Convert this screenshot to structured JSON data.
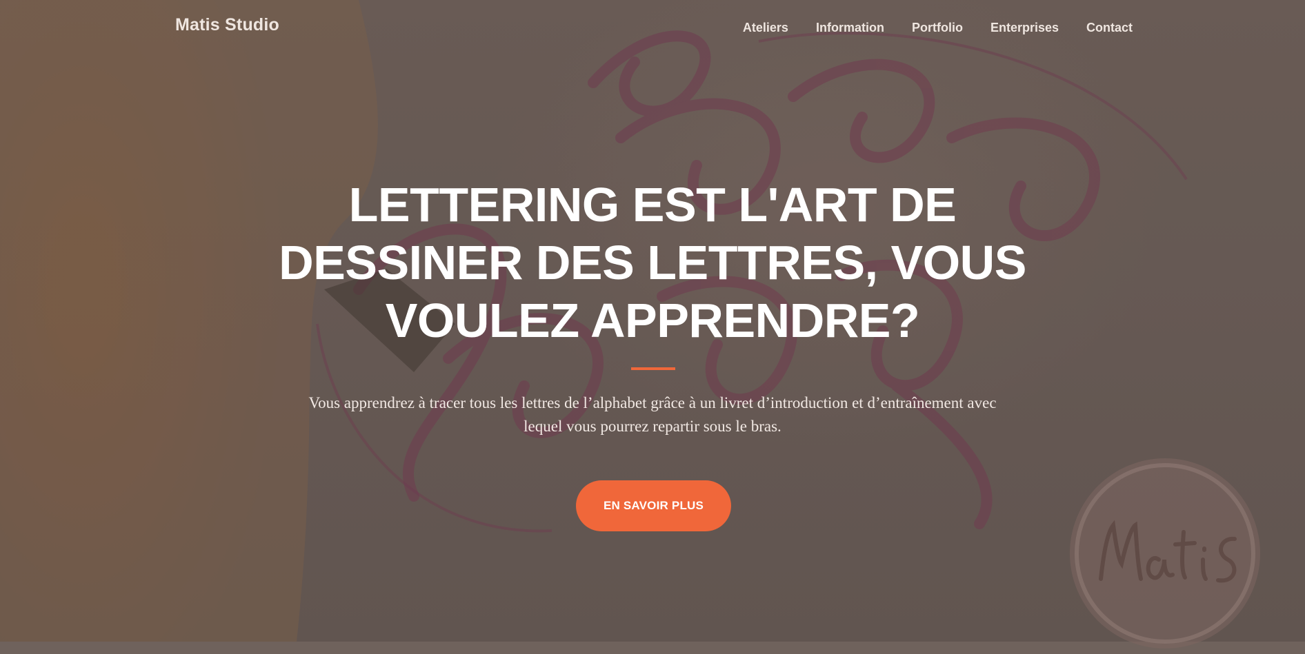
{
  "header": {
    "brand": "Matis Studio",
    "nav": [
      {
        "label": "Ateliers"
      },
      {
        "label": "Information"
      },
      {
        "label": "Portfolio"
      },
      {
        "label": "Enterprises"
      },
      {
        "label": "Contact"
      }
    ]
  },
  "hero": {
    "title": "LETTERING EST L'ART DE DESSINER DES LETTRES, VOUS VOULEZ APPRENDRE?",
    "subtitle": "Vous apprendrez à tracer tous les lettres de l’alphabet grâce à un livret d’introduction et d’entraînement avec lequel vous pourrez repartir sous le bras.",
    "cta_label": "EN SAVOIR PLUS",
    "background_icon": "calligraphy-photo"
  },
  "seal": {
    "logo_text": "Matis",
    "icon": "matis-logo-seal"
  },
  "colors": {
    "accent": "#f0673a",
    "text_light": "#ffffff",
    "nav_text": "#efe6e0"
  }
}
